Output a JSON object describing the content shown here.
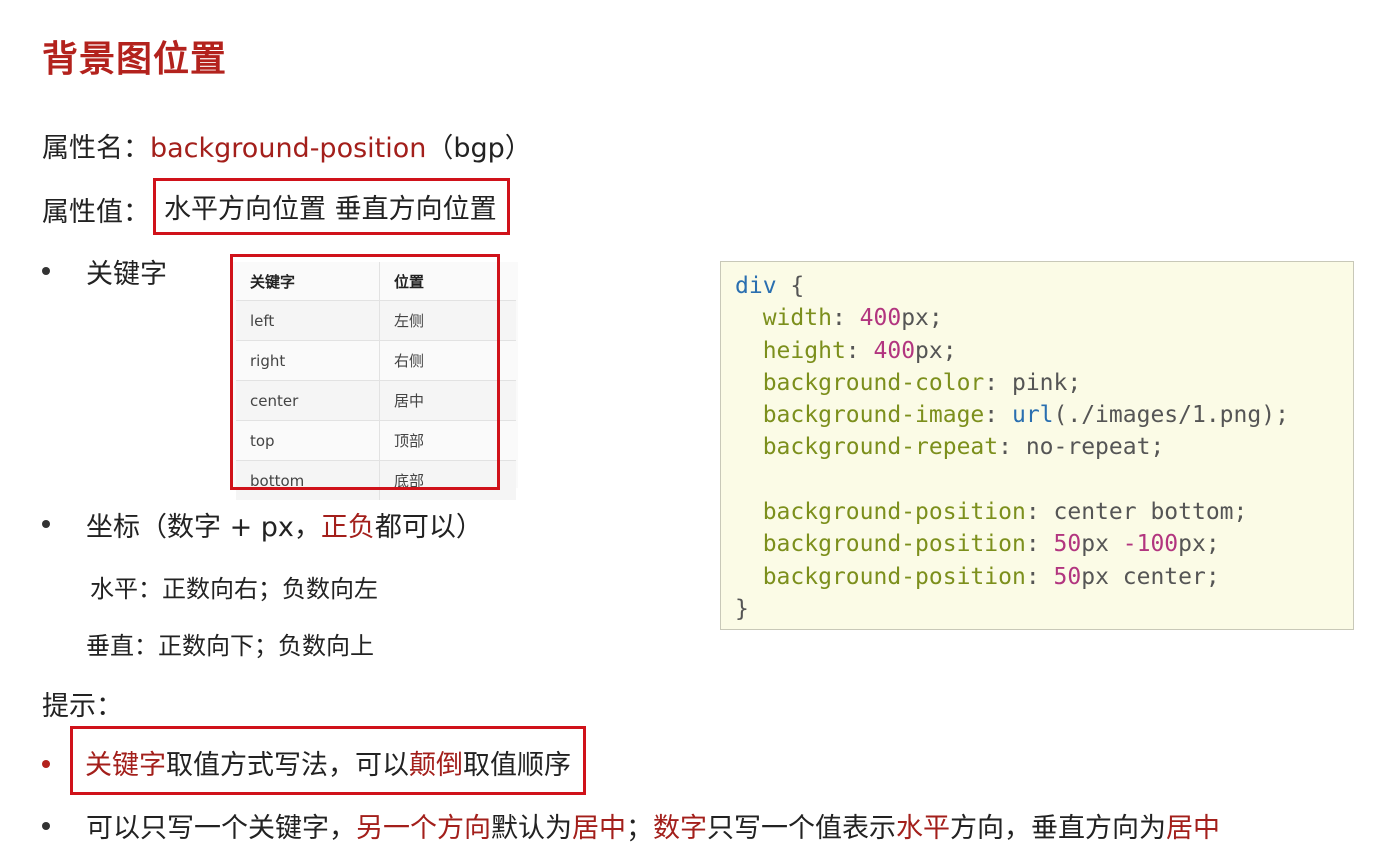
{
  "title": "背景图位置",
  "prop_name": {
    "label": "属性名：",
    "value": "background-position",
    "abbr": "（bgp）"
  },
  "prop_value": {
    "label": "属性值：",
    "value": "水平方向位置 垂直方向位置"
  },
  "keyword_heading": "关键字",
  "keyword_table": {
    "headers": [
      "关键字",
      "位置"
    ],
    "rows": [
      [
        "left",
        "左侧"
      ],
      [
        "right",
        "右侧"
      ],
      [
        "center",
        "居中"
      ],
      [
        "top",
        "顶部"
      ],
      [
        "bottom",
        "底部"
      ]
    ]
  },
  "coord": {
    "prefix": "坐标（数字 + px，",
    "highlight": "正负",
    "suffix": "都可以）",
    "horizontal": "水平：正数向右；负数向左",
    "vertical": "垂直：正数向下；负数向上"
  },
  "tips": {
    "label": "提示：",
    "tip1": {
      "a": "关键字",
      "b": "取值方式写法，可以",
      "c": "颠倒",
      "d": "取值顺序"
    },
    "tip2": {
      "a": "可以只写一个关键字，",
      "b": "另一个方向",
      "c": "默认为",
      "d": "居中",
      "e": "；",
      "f": "数字",
      "g": "只写一个值表示",
      "h": "水平",
      "i": "方向，垂直方向为",
      "j": "居中"
    }
  },
  "code": {
    "selector": "div",
    "open": " {",
    "close": "}",
    "lines": [
      {
        "prop": "width",
        "num": "400",
        "unit": "px;"
      },
      {
        "prop": "height",
        "num": "400",
        "unit": "px;"
      },
      {
        "prop": "background-color",
        "val": "pink;"
      },
      {
        "prop": "background-image",
        "fn": "url",
        "val": "(./images/1.png);"
      },
      {
        "prop": "background-repeat",
        "val": "no-repeat;"
      },
      {
        "prop": "background-position",
        "val": "center bottom;"
      },
      {
        "prop": "background-position",
        "num": "50",
        "unit": "px ",
        "num2": "-100",
        "unit2": "px;"
      },
      {
        "prop": "background-position",
        "num": "50",
        "unit": "px center;"
      }
    ]
  },
  "colors": {
    "accent": "#b3221d",
    "box": "#d0121a",
    "code_bg": "#fbfbe6"
  }
}
